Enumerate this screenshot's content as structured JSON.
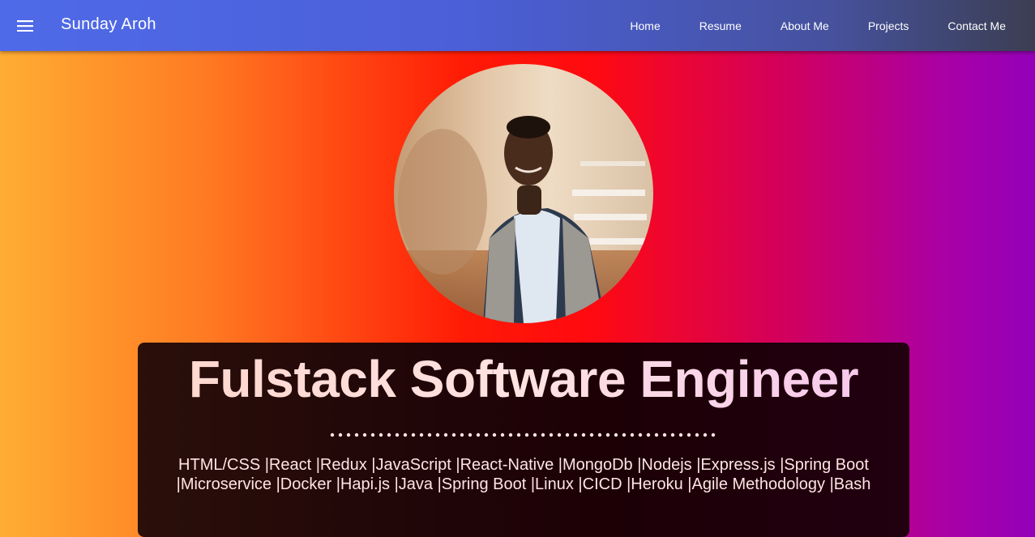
{
  "header": {
    "brand": "Sunday Aroh",
    "nav": [
      "Home",
      "Resume",
      "About Me",
      "Projects",
      "Contact Me"
    ]
  },
  "hero": {
    "title": "Fulstack Software Engineer",
    "skills_line1": "HTML/CSS |React |Redux |JavaScript |React-Native |MongoDb |Nodejs |Express.js |Spring Boot",
    "skills_line2": "|Microservice |Docker |Hapi.js |Java |Spring Boot |Linux |CICD |Heroku |Agile Methodology |Bash"
  },
  "colors": {
    "appbar": "#4f6ae8",
    "accent_orange": "#ff7a22",
    "accent_red": "#ff0a10",
    "accent_purple": "#9400b8"
  },
  "icons": {
    "menu": "hamburger-menu-icon",
    "avatar": "profile-photo"
  }
}
